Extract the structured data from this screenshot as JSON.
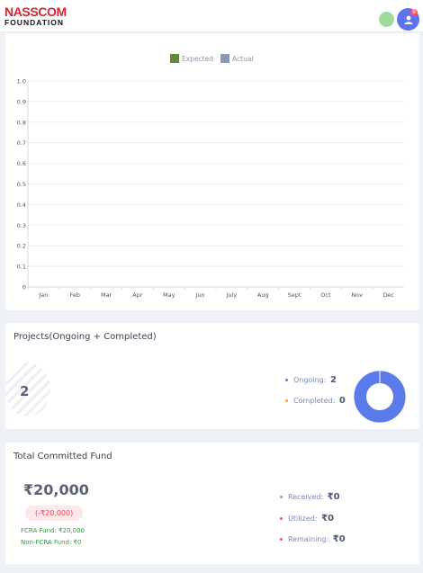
{
  "header": {
    "brand_line1": "NASSCOM",
    "brand_line2": "FOUNDATION",
    "notification_count": "9"
  },
  "chart_data": {
    "type": "bar",
    "categories": [
      "Jan",
      "Feb",
      "Mar",
      "Apr",
      "May",
      "Jun",
      "July",
      "Aug",
      "Sept",
      "Oct",
      "Nov",
      "Dec"
    ],
    "series": [
      {
        "name": "Expected",
        "color": "#5a8a3a",
        "values": [
          0,
          0,
          0,
          0,
          0,
          0,
          0,
          0,
          0,
          0,
          0,
          0
        ]
      },
      {
        "name": "Actual",
        "color": "#8a9ab5",
        "values": [
          0,
          0,
          0,
          0,
          0,
          0,
          0,
          0,
          0,
          0,
          0,
          0
        ]
      }
    ],
    "yticks": [
      "0",
      "0.1",
      "0.2",
      "0.3",
      "0.4",
      "0.5",
      "0.6",
      "0.7",
      "0.8",
      "0.9",
      "1.0"
    ],
    "ylim": [
      0,
      1
    ],
    "legend": "top-center",
    "grid": true
  },
  "projects": {
    "title": "Projects(Ongoing + Completed)",
    "total": "2",
    "ongoing_label": "Ongoing:",
    "ongoing_value": "2",
    "completed_label": "Completed:",
    "completed_value": "0",
    "ongoing_color": "#5b7bea",
    "completed_color": "#f6a623"
  },
  "fund": {
    "title": "Total Committed Fund",
    "amount": "₹20,000",
    "pending": "(-₹20,000)",
    "fcra": "FCRA Fund: ₹20,000",
    "non_fcra": "Non-FCRA Fund: ₹0",
    "received_label": "Received:",
    "received_value": "₹0",
    "utilized_label": "Utilized:",
    "utilized_value": "₹0",
    "remaining_label": "Remaining:",
    "remaining_value": "₹0",
    "received_color": "#35c9b4",
    "utilized_color": "#ff4d6d",
    "remaining_color": "#ff4d6d"
  }
}
